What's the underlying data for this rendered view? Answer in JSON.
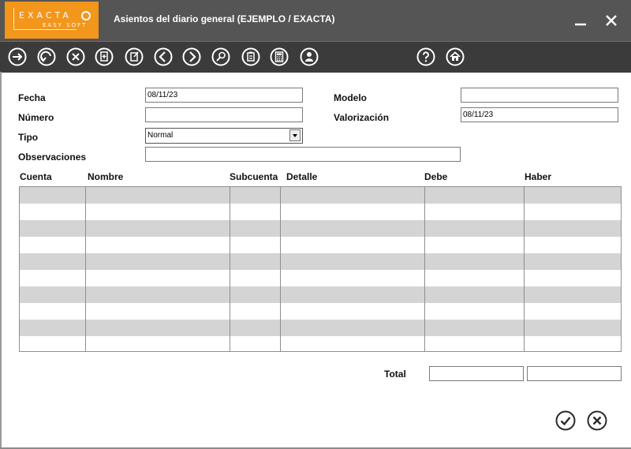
{
  "app": {
    "logo_main": "EXACTA",
    "logo_sub": "EASY SOFT",
    "window_title": "Asientos del diario general (EJEMPLO / EXACTA)"
  },
  "toolbar": {
    "icons": [
      "arrow-right-icon",
      "undo-icon",
      "close-circle-icon",
      "new-document-icon",
      "edit-document-icon",
      "chevron-left-icon",
      "chevron-right-icon",
      "search-icon",
      "clipboard-icon",
      "calculator-icon",
      "user-icon",
      "help-icon",
      "home-icon"
    ]
  },
  "form": {
    "fecha_label": "Fecha",
    "fecha_value": "08/11/23",
    "numero_label": "Número",
    "numero_value": "",
    "tipo_label": "Tipo",
    "tipo_value": "Normal",
    "observaciones_label": "Observaciones",
    "observaciones_value": "",
    "modelo_label": "Modelo",
    "modelo_value": "",
    "valorizacion_label": "Valorización",
    "valorizacion_value": "08/11/23"
  },
  "table": {
    "columns": [
      "Cuenta",
      "Nombre",
      "Subcuenta",
      "Detalle",
      "Debe",
      "Haber"
    ],
    "rows": []
  },
  "footer": {
    "total_label": "Total",
    "total_debe": "",
    "total_haber": ""
  },
  "colors": {
    "title_bg": "#555555",
    "toolbar_bg": "#3b3b3b",
    "logo_bg": "#f2961c",
    "row_alt": "#d4d4d4"
  }
}
